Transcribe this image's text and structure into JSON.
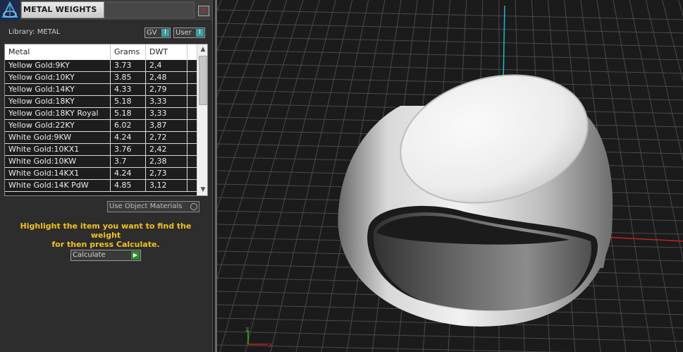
{
  "panel": {
    "title": "METAL WEIGHTS",
    "close_glyph": "✕",
    "library_label": "Library: METAL",
    "gv_toggle": "GV",
    "user_toggle": "User",
    "toggle_glyph": "I",
    "columns": {
      "metal": "Metal",
      "grams": "Grams",
      "dwt": "DWT"
    },
    "rows": [
      {
        "metal": "Yellow Gold:9KY",
        "grams": "3.73",
        "dwt": "2,4"
      },
      {
        "metal": "Yellow Gold:10KY",
        "grams": "3.85",
        "dwt": "2,48"
      },
      {
        "metal": "Yellow Gold:14KY",
        "grams": "4.33",
        "dwt": "2,79"
      },
      {
        "metal": "Yellow Gold:18KY",
        "grams": "5.18",
        "dwt": "3,33"
      },
      {
        "metal": "Yellow Gold:18KY Royal",
        "grams": "5.18",
        "dwt": "3,33"
      },
      {
        "metal": "Yellow Gold:22KY",
        "grams": "6.02",
        "dwt": "3,87"
      },
      {
        "metal": "White Gold:9KW",
        "grams": "4.24",
        "dwt": "2,72"
      },
      {
        "metal": "White Gold:10KX1",
        "grams": "3.76",
        "dwt": "2,42"
      },
      {
        "metal": "White Gold:10KW",
        "grams": "3.7",
        "dwt": "2,38"
      },
      {
        "metal": "White Gold:14KX1",
        "grams": "4.24",
        "dwt": "2,73"
      },
      {
        "metal": "White Gold:14K PdW",
        "grams": "4.85",
        "dwt": "3,12"
      }
    ],
    "use_object_materials": "Use Object Materials",
    "instructions_line1": "Highlight the item you want to find the weight",
    "instructions_line2": "for then press Calculate.",
    "calculate_label": "Calculate",
    "calculate_icon": "play-arrow-icon",
    "accent_color": "#f3c21b",
    "toggle_color": "#3aa0a6"
  },
  "viewport": {
    "axis_x_color": "#c0241f",
    "axis_y_color": "#1fb8c6",
    "axis_z_color": "#3caa3c",
    "gizmo_x": "x",
    "gizmo_z": "z",
    "object": "signet-ring"
  }
}
